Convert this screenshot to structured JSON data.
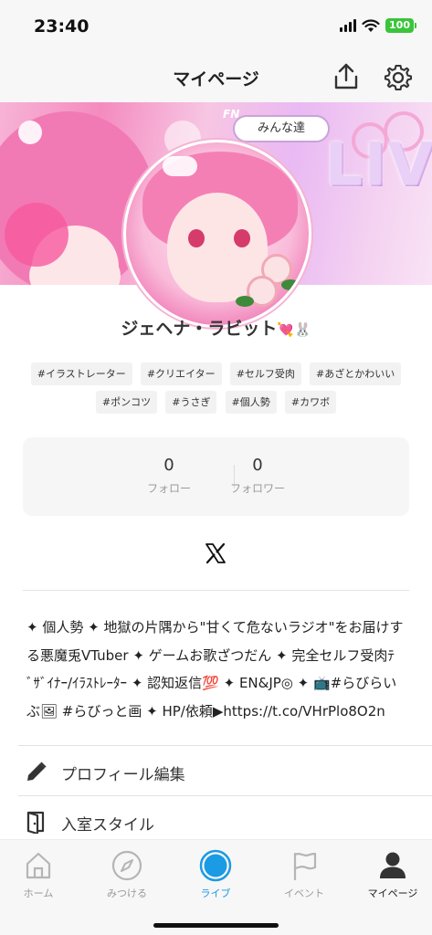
{
  "status_bar": {
    "time": "23:40",
    "battery": "100",
    "battery_color": "#3ac43a"
  },
  "nav": {
    "title": "マイページ",
    "share_icon": "share-icon",
    "settings_icon": "gear-icon"
  },
  "banner": {
    "tag_label": "みんな達",
    "fn_text": "FN",
    "live_text": "LIVE"
  },
  "profile": {
    "name": "ジェヘナ・ラビット",
    "name_emoji": "💘🐰",
    "tags_row1": [
      "#イラストレーター",
      "#クリエイター",
      "#セルフ受肉",
      "#あざとかわいい"
    ],
    "tags_row2": [
      "#ポンコツ",
      "#うさぎ",
      "#個人勢",
      "#カワボ"
    ]
  },
  "follow": {
    "following_count": "0",
    "following_label": "フォロー",
    "followers_count": "0",
    "followers_label": "フォロワー"
  },
  "social": {
    "x_icon": "x-logo-icon"
  },
  "bio": {
    "lines": [
      "✦ 個人勢 ✦ 地獄の片隅から\"甘くて危ないラジオ\"をお届けす",
      "る悪魔兎VTuber ✦ ゲームお歌ざつだん ✦ 完全セルフ受肉ﾃ",
      "ﾞｻﾞｲﾅｰ/ｲﾗｽﾄﾚｰﾀｰ ✦ 認知返信💯 ✦ EN&JP◎ ✦ 📺#らびらい",
      "ぶ🖼 #らびっと画 ✦ HP/依頼▶https://t.co/VHrPlo8O2n"
    ]
  },
  "menu": {
    "items": [
      {
        "label": "プロフィール編集",
        "icon": "pencil-icon"
      },
      {
        "label": "入室スタイル",
        "icon": "door-icon"
      }
    ]
  },
  "tab_bar": {
    "tabs": [
      {
        "label": "ホーム",
        "icon": "home-icon",
        "state": "inactive"
      },
      {
        "label": "みつける",
        "icon": "compass-icon",
        "state": "inactive"
      },
      {
        "label": "ライブ",
        "icon": "live-icon",
        "state": "active-live"
      },
      {
        "label": "イベント",
        "icon": "flag-icon",
        "state": "inactive"
      },
      {
        "label": "マイページ",
        "icon": "person-icon",
        "state": "active"
      }
    ],
    "live_color": "#1a9be3"
  }
}
